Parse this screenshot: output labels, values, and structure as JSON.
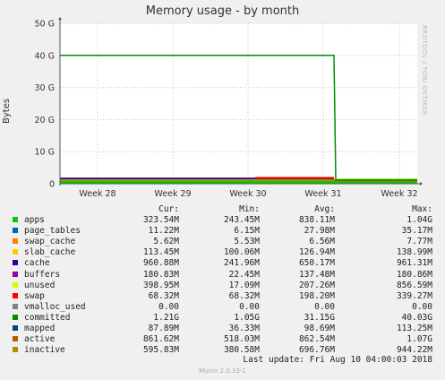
{
  "chart_data": {
    "type": "area",
    "title": "Memory usage - by month",
    "ylabel": "Bytes",
    "vendor": "RRDTOOL / TOBI OETIKER",
    "yticks": [
      "0",
      "10 G",
      "20 G",
      "30 G",
      "40 G",
      "50 G"
    ],
    "ylim": [
      0,
      50
    ],
    "xticks": [
      "Week 28",
      "Week 29",
      "Week 30",
      "Week 31",
      "Week 32"
    ],
    "grid": true,
    "series": [
      {
        "name": "apps",
        "color": "#00cc00",
        "cur": "323.54M",
        "min": "243.45M",
        "avg": "838.11M",
        "max": "1.04G"
      },
      {
        "name": "page_tables",
        "color": "#0066b3",
        "cur": "11.22M",
        "min": "6.15M",
        "avg": "27.98M",
        "max": "35.17M"
      },
      {
        "name": "swap_cache",
        "color": "#ff8000",
        "cur": "5.62M",
        "min": "5.53M",
        "avg": "6.56M",
        "max": "7.77M"
      },
      {
        "name": "slab_cache",
        "color": "#ffcc00",
        "cur": "113.45M",
        "min": "100.06M",
        "avg": "126.94M",
        "max": "138.99M"
      },
      {
        "name": "cache",
        "color": "#330099",
        "cur": "960.88M",
        "min": "241.96M",
        "avg": "650.17M",
        "max": "961.31M"
      },
      {
        "name": "buffers",
        "color": "#990099",
        "cur": "180.83M",
        "min": "22.45M",
        "avg": "137.48M",
        "max": "180.86M"
      },
      {
        "name": "unused",
        "color": "#ccff00",
        "cur": "398.95M",
        "min": "17.09M",
        "avg": "207.26M",
        "max": "856.59M"
      },
      {
        "name": "swap",
        "color": "#ff0000",
        "cur": "68.32M",
        "min": "68.32M",
        "avg": "198.20M",
        "max": "339.27M"
      },
      {
        "name": "vmalloc_used",
        "color": "#808080",
        "cur": "0.00",
        "min": "0.00",
        "avg": "0.00",
        "max": "0.00"
      },
      {
        "name": "committed",
        "color": "#008f00",
        "cur": "1.21G",
        "min": "1.05G",
        "avg": "31.15G",
        "max": "40.03G"
      },
      {
        "name": "mapped",
        "color": "#00487d",
        "cur": "87.89M",
        "min": "36.33M",
        "avg": "98.69M",
        "max": "113.25M"
      },
      {
        "name": "active",
        "color": "#b35a00",
        "cur": "861.62M",
        "min": "518.03M",
        "avg": "862.54M",
        "max": "1.07G"
      },
      {
        "name": "inactive",
        "color": "#b38f00",
        "cur": "595.83M",
        "min": "380.58M",
        "avg": "696.76M",
        "max": "944.22M"
      }
    ],
    "legend_headers": {
      "cur": "Cur:",
      "min": "Min:",
      "avg": "Avg:",
      "max": "Max:"
    },
    "committed_line": {
      "level_before": 40.0,
      "level_after": 1.21,
      "drop_week": 31
    }
  },
  "footer": {
    "last_update": "Last update:  Fri Aug 10 04:00:03 2018",
    "munin": "Munin 2.0.33-1"
  }
}
